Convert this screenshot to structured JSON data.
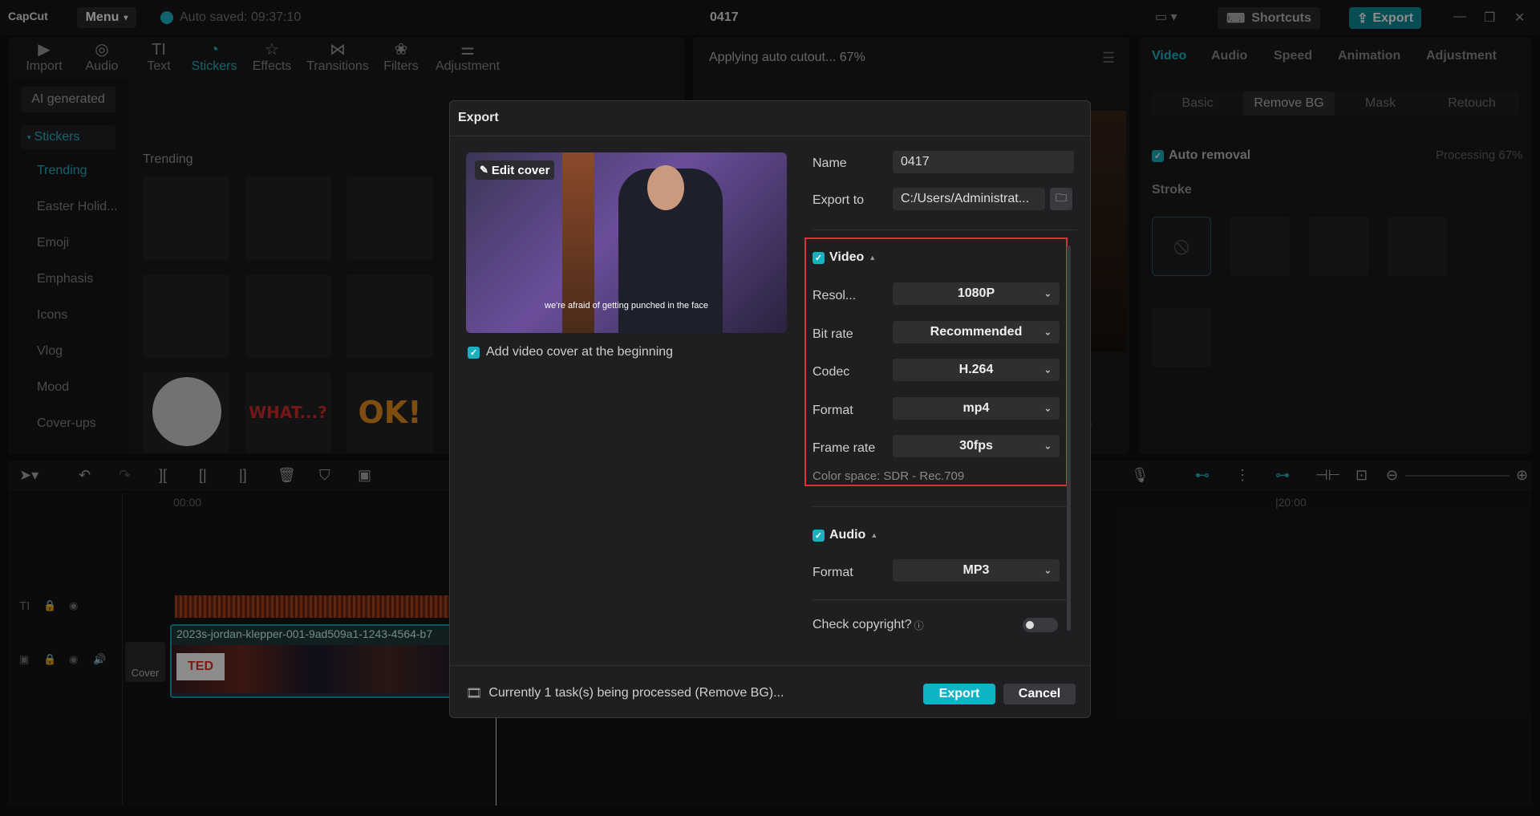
{
  "app": {
    "logo": "CapCut",
    "menu_label": "Menu",
    "autosave_text": "Auto saved: 09:37:10",
    "project_title": "0417",
    "shortcuts_label": "Shortcuts",
    "export_label": "Export"
  },
  "toolbar": {
    "items": [
      {
        "label": "Import",
        "icon": "import-icon"
      },
      {
        "label": "Audio",
        "icon": "audio-icon"
      },
      {
        "label": "Text",
        "icon": "text-icon"
      },
      {
        "label": "Stickers",
        "icon": "stickers-icon"
      },
      {
        "label": "Effects",
        "icon": "effects-icon"
      },
      {
        "label": "Transitions",
        "icon": "transitions-icon"
      },
      {
        "label": "Filters",
        "icon": "filters-icon"
      },
      {
        "label": "Adjustment",
        "icon": "adjustment-icon"
      }
    ]
  },
  "sidebar": {
    "ai_generated": "AI generated",
    "stickers_header": "Stickers",
    "items": [
      "Trending",
      "Easter Holid...",
      "Emoji",
      "Emphasis",
      "Icons",
      "Vlog",
      "Mood",
      "Cover-ups"
    ]
  },
  "stickers_panel": {
    "section_title": "Trending",
    "sticker_texts": [
      "WHAT...?",
      "OK!"
    ]
  },
  "player": {
    "status": "Applying auto cutout... 67%"
  },
  "right_panel": {
    "tabs": [
      "Video",
      "Audio",
      "Speed",
      "Animation",
      "Adjustment"
    ],
    "subtabs": [
      "Basic",
      "Remove BG",
      "Mask",
      "Retouch"
    ],
    "auto_removal_label": "Auto removal",
    "processing_text": "Processing 67%",
    "stroke_label": "Stroke"
  },
  "timeline": {
    "ruler_start": "00:00",
    "ruler_end": "|20:00",
    "clip_name": "2023s-jordan-klepper-001-9ad509a1-1243-4564-b7",
    "cover_label": "Cover",
    "clip_logo": "TED"
  },
  "dialog": {
    "title": "Export",
    "edit_cover": "Edit cover",
    "subtitle_text": "we're afraid of getting punched in the face",
    "add_cover_label": "Add video cover at the beginning",
    "add_cover_checked": true,
    "name_label": "Name",
    "name_value": "0417",
    "export_to_label": "Export to",
    "export_to_value": "C:/Users/Administrat...",
    "video_section": "Video",
    "video_checked": true,
    "video_settings": [
      {
        "label": "Resol...",
        "value": "1080P"
      },
      {
        "label": "Bit rate",
        "value": "Recommended"
      },
      {
        "label": "Codec",
        "value": "H.264"
      },
      {
        "label": "Format",
        "value": "mp4"
      },
      {
        "label": "Frame rate",
        "value": "30fps"
      }
    ],
    "color_space": "Color space: SDR - Rec.709",
    "audio_section": "Audio",
    "audio_checked": true,
    "audio_format_label": "Format",
    "audio_format_value": "MP3",
    "copyright_label": "Check copyright?",
    "copyright_enabled": false,
    "footer_status": "Currently 1 task(s) being processed (Remove BG)...",
    "export_button": "Export",
    "cancel_button": "Cancel"
  },
  "colors": {
    "accent": "#22b8c8",
    "highlight_border": "#e0303a",
    "export_button": "#0fb4c4"
  }
}
